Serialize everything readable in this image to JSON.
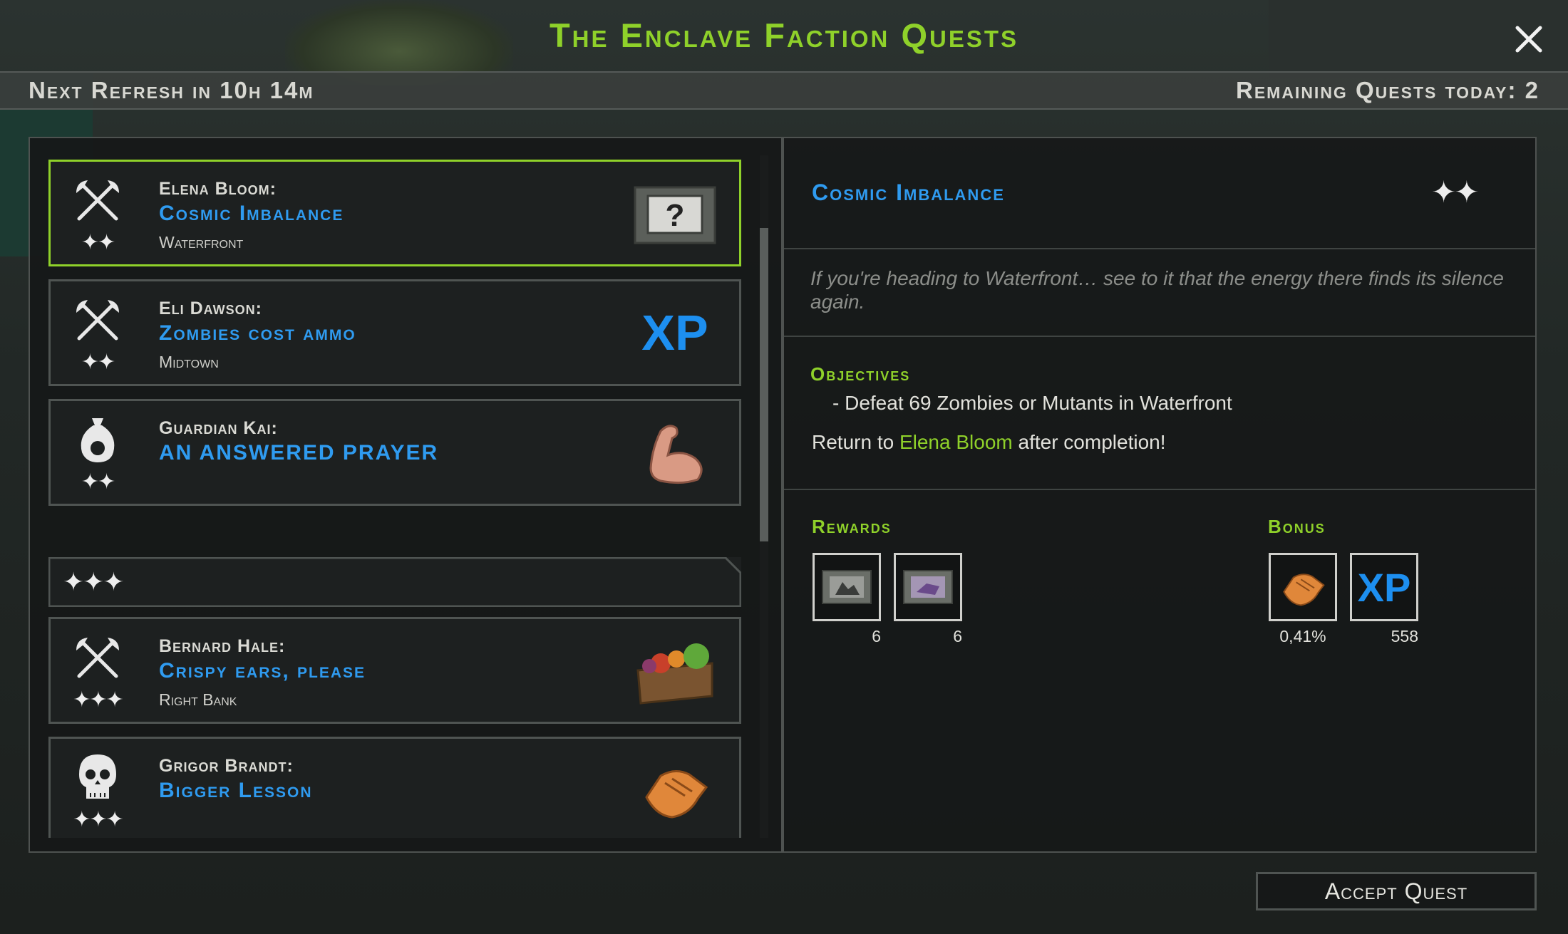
{
  "window": {
    "title": "The Enclave Faction Quests",
    "close_icon": "close-icon"
  },
  "infobar": {
    "refresh": "Next Refresh in 10h 14m",
    "remaining": "Remaining Quests today: 2"
  },
  "quests": [
    {
      "giver": "Elena Bloom:",
      "name": "Cosmic Imbalance",
      "location": "Waterfront",
      "stars": "✦✦",
      "icon": "crossed-axes-icon",
      "reward_icon": "mystery-crate-icon",
      "selected": true
    },
    {
      "giver": "Eli Dawson:",
      "name": "Zombies cost ammo",
      "location": "Midtown",
      "stars": "✦✦",
      "icon": "crossed-axes-icon",
      "reward_icon": "xp-icon",
      "reward_text": "XP"
    },
    {
      "giver": "Guardian Kai:",
      "name": "AN ANSWERED PRAYER",
      "location": "",
      "stars": "✦✦",
      "icon": "money-bag-icon",
      "reward_icon": "flexed-arm-icon"
    },
    {
      "giver": "Bernard Hale:",
      "name": "Crispy ears, please",
      "location": "Right Bank",
      "stars": "✦✦✦",
      "icon": "crossed-axes-icon",
      "reward_icon": "vegetable-crate-icon"
    },
    {
      "giver": "Grigor Brandt:",
      "name": "Bigger Lesson",
      "location": "",
      "stars": "✦✦✦",
      "icon": "skull-icon",
      "reward_icon": "handshake-icon"
    }
  ],
  "tier_header": {
    "stars": "✦✦✦"
  },
  "detail": {
    "title": "Cosmic Imbalance",
    "stars": "✦✦",
    "description": "If you're heading to Waterfront… see to it that the energy there finds its silence again.",
    "objectives_label": "Objectives",
    "objective": "- Defeat 69 Zombies or Mutants in Waterfront",
    "return_prefix": "Return to ",
    "return_npc": "Elena Bloom",
    "return_suffix": " after completion!",
    "rewards_label": "Rewards",
    "bonus_label": "Bonus",
    "rewards": [
      {
        "icon": "metal-scrap-crate-icon",
        "count": "6"
      },
      {
        "icon": "purple-material-crate-icon",
        "count": "6"
      }
    ],
    "bonus": [
      {
        "icon": "handshake-icon",
        "count": "0,41%"
      },
      {
        "icon": "xp-icon",
        "text": "XP",
        "count": "558"
      }
    ]
  },
  "accept_button": "Accept Quest",
  "colors": {
    "accent_green": "#8fd12a",
    "quest_blue": "#2f9bf0"
  }
}
